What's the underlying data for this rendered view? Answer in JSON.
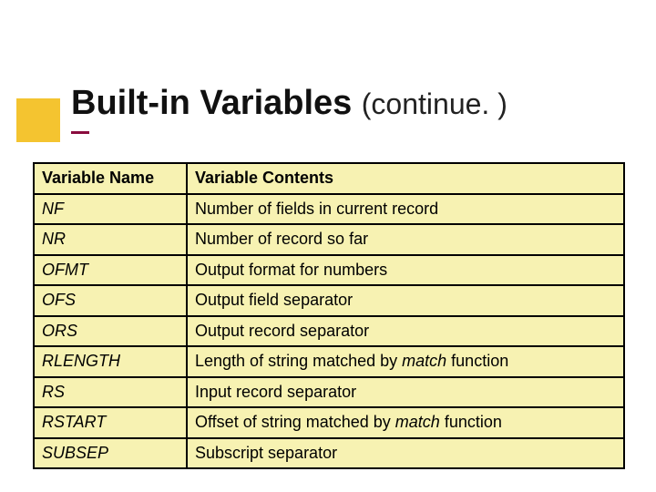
{
  "title": {
    "main": "Built-in Variables",
    "cont": "(continue. )"
  },
  "table": {
    "headers": {
      "name": "Variable Name",
      "contents": "Variable Contents"
    },
    "rows": [
      {
        "name": "NF",
        "desc_pre": "Number of fields in current record",
        "kw": "",
        "desc_post": ""
      },
      {
        "name": "NR",
        "desc_pre": "Number of record so far",
        "kw": "",
        "desc_post": ""
      },
      {
        "name": "OFMT",
        "desc_pre": "Output format for numbers",
        "kw": "",
        "desc_post": ""
      },
      {
        "name": "OFS",
        "desc_pre": "Output field separator",
        "kw": "",
        "desc_post": ""
      },
      {
        "name": "ORS",
        "desc_pre": "Output record separator",
        "kw": "",
        "desc_post": ""
      },
      {
        "name": "RLENGTH",
        "desc_pre": "Length of string matched by ",
        "kw": "match",
        "desc_post": " function"
      },
      {
        "name": "RS",
        "desc_pre": "Input record separator",
        "kw": "",
        "desc_post": ""
      },
      {
        "name": "RSTART",
        "desc_pre": "Offset of string matched by ",
        "kw": "match",
        "desc_post": " function"
      },
      {
        "name": "SUBSEP",
        "desc_pre": "Subscript separator",
        "kw": "",
        "desc_post": ""
      }
    ]
  }
}
